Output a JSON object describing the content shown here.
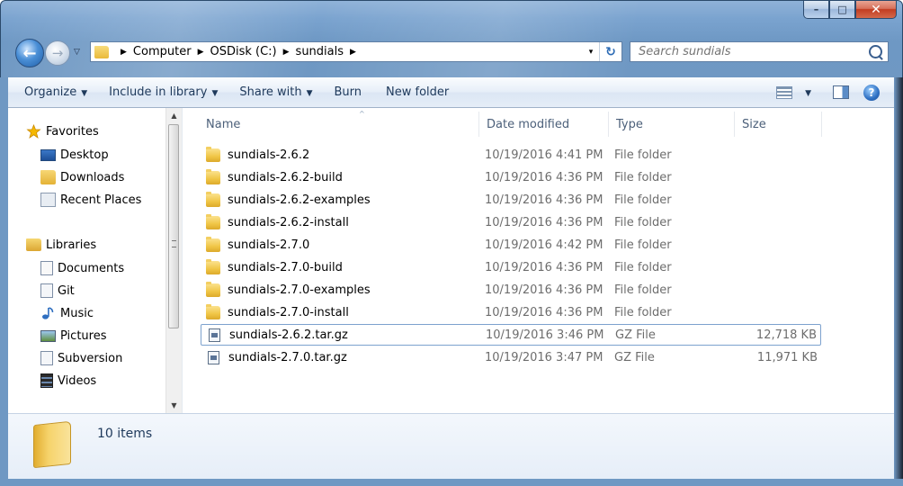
{
  "window": {
    "caption_buttons": {
      "minimize": "–",
      "maximize": "□",
      "close": "✕"
    }
  },
  "nav": {
    "back_icon": "back-arrow-icon",
    "forward_icon": "forward-arrow-icon",
    "back_glyph": "←",
    "forward_glyph": "→",
    "recent_glyph": "▽"
  },
  "address": {
    "crumbs": [
      "Computer",
      "OSDisk (C:)",
      "sundials"
    ],
    "separator": "▶",
    "dropdown_glyph": "▾",
    "refresh_glyph": "↻"
  },
  "search": {
    "placeholder": "Search sundials",
    "value": ""
  },
  "toolbar": {
    "organize": "Organize",
    "include_in_library": "Include in library",
    "share_with": "Share with",
    "burn": "Burn",
    "new_folder": "New folder",
    "dropdown_glyph": "▼",
    "help_glyph": "?"
  },
  "sidebar": {
    "favorites_label": "Favorites",
    "favorites": [
      "Desktop",
      "Downloads",
      "Recent Places"
    ],
    "libraries_label": "Libraries",
    "libraries": [
      "Documents",
      "Git",
      "Music",
      "Pictures",
      "Subversion",
      "Videos"
    ],
    "scroll_up": "▲",
    "scroll_down": "▼"
  },
  "columns": {
    "name": "Name",
    "date": "Date modified",
    "type": "Type",
    "size": "Size",
    "sort_glyph": "^"
  },
  "files": [
    {
      "name": "sundials-2.6.2",
      "date": "10/19/2016 4:41 PM",
      "type": "File folder",
      "size": "",
      "kind": "folder"
    },
    {
      "name": "sundials-2.6.2-build",
      "date": "10/19/2016 4:36 PM",
      "type": "File folder",
      "size": "",
      "kind": "folder"
    },
    {
      "name": "sundials-2.6.2-examples",
      "date": "10/19/2016 4:36 PM",
      "type": "File folder",
      "size": "",
      "kind": "folder"
    },
    {
      "name": "sundials-2.6.2-install",
      "date": "10/19/2016 4:36 PM",
      "type": "File folder",
      "size": "",
      "kind": "folder"
    },
    {
      "name": "sundials-2.7.0",
      "date": "10/19/2016 4:42 PM",
      "type": "File folder",
      "size": "",
      "kind": "folder"
    },
    {
      "name": "sundials-2.7.0-build",
      "date": "10/19/2016 4:36 PM",
      "type": "File folder",
      "size": "",
      "kind": "folder"
    },
    {
      "name": "sundials-2.7.0-examples",
      "date": "10/19/2016 4:36 PM",
      "type": "File folder",
      "size": "",
      "kind": "folder"
    },
    {
      "name": "sundials-2.7.0-install",
      "date": "10/19/2016 4:36 PM",
      "type": "File folder",
      "size": "",
      "kind": "folder"
    },
    {
      "name": "sundials-2.6.2.tar.gz",
      "date": "10/19/2016 3:46 PM",
      "type": "GZ File",
      "size": "12,718 KB",
      "kind": "gz",
      "selected": true
    },
    {
      "name": "sundials-2.7.0.tar.gz",
      "date": "10/19/2016 3:47 PM",
      "type": "GZ File",
      "size": "11,971 KB",
      "kind": "gz"
    }
  ],
  "status": {
    "item_count": "10 items"
  }
}
